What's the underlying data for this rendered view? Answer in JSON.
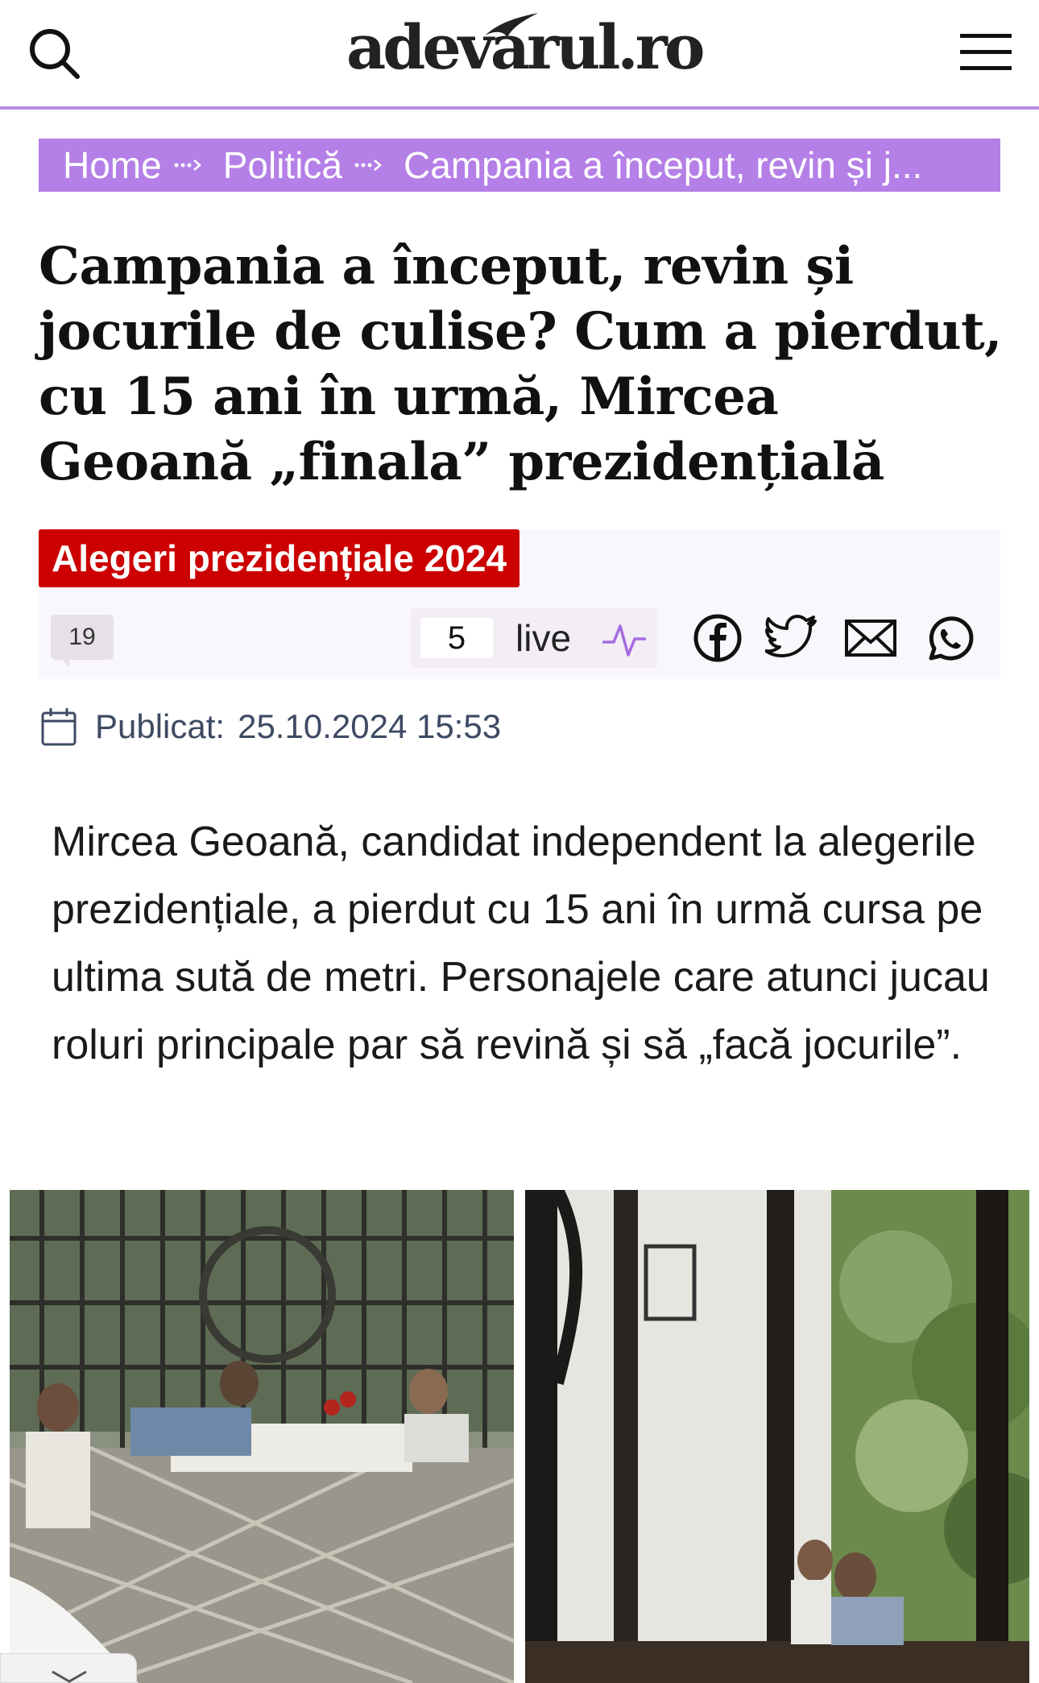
{
  "header": {
    "logo_text": "adevarul.ro",
    "search_icon": "search-icon",
    "menu_icon": "hamburger-menu-icon",
    "accent_color": "#b68ce6"
  },
  "breadcrumb": {
    "items": [
      "Home",
      "Politică",
      "Campania a început, revin și j..."
    ],
    "background": "#b47fe6"
  },
  "article": {
    "title": "Campania a început, revin și jocurile de culise? Cum a pierdut, cu 15 ani în urmă, Mircea Geoană „finala” prezidențială",
    "tag": "Alegeri prezidențiale 2024",
    "tag_color": "#cc0000",
    "comments_count": "19",
    "live_count": "5",
    "live_label": "live",
    "share_icons": [
      "facebook-icon",
      "twitter-icon",
      "email-icon",
      "whatsapp-icon"
    ],
    "published_label": "Publicat:",
    "published_date": "25.10.2024 15:53",
    "lead": "Mircea Geoană, candidat independent la alegerile prezidențiale, a pierdut cu 15 ani în urmă cursa pe ultima sută de metri. Personajele care atunci jucau roluri principale par să revină și să „facă jocurile”."
  }
}
